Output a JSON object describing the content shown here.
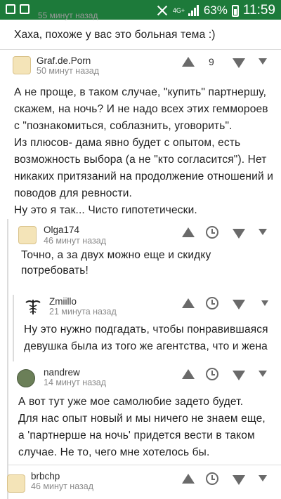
{
  "status_bar": {
    "network": "4G+",
    "battery": "63%",
    "time": "11:59"
  },
  "top": {
    "faded_time": "55 минут назад",
    "text": "Хаха, похоже у вас это больная тема :)"
  },
  "comments": [
    {
      "user": "Graf.de.Porn",
      "time": "50 минут назад",
      "score": "9",
      "lines": [
        "А не проще, в таком случае, \"купить\" партнершу,",
        "скажем, на ночь? И не надо всех этих геммороев",
        "с \"познакомиться, соблазнить, уговорить\".",
        "Из плюсов- дама явно будет с опытом, есть",
        "возможность выбора (а не \"кто согласится\"). Нет",
        "никаких притязаний на продолжение отношений и",
        "поводов для ревности.",
        "Ну это я так... Чисто гипотетически."
      ]
    },
    {
      "user": "Olga174",
      "time": "46 минут назад",
      "lines": [
        "Точно, а за двух можно еще и скидку",
        "потребовать!"
      ]
    },
    {
      "user": "Zmiillo",
      "time": "21 минута назад",
      "lines": [
        "Ну это нужно подгадать, чтобы понравившаяся",
        "девушка была из того же агентства, что и жена"
      ]
    },
    {
      "user": "nandrew",
      "time": "14 минут назад",
      "lines": [
        "А вот тут уже мое самолюбие задето будет.",
        "Для нас опыт новый и мы ничего не знаем еще,",
        "а 'партнерше на ночь' придется вести в таком",
        "случае. Не то, чего мне хотелось бы."
      ]
    },
    {
      "user": "brbchp",
      "time": "46 минут назад"
    }
  ]
}
